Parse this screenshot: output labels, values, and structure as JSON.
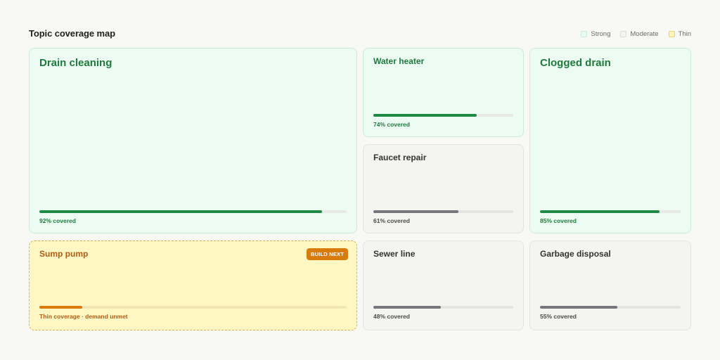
{
  "header": {
    "title": "Topic coverage map"
  },
  "legend": [
    {
      "label": "Strong",
      "color": "#edfcf2",
      "border": "#c9ecd5"
    },
    {
      "label": "Moderate",
      "color": "#f4f4f1",
      "border": "#dcdcd8"
    },
    {
      "label": "Thin",
      "color": "#fef3b8",
      "border": "#ecd27a"
    }
  ],
  "topics": {
    "drain_cleaning": {
      "name": "Drain cleaning",
      "level": "strong",
      "coverage": 0.92,
      "status": "92% covered"
    },
    "water_heater": {
      "name": "Water heater",
      "level": "strong",
      "coverage": 0.74,
      "status": "74% covered"
    },
    "faucet_repair": {
      "name": "Faucet repair",
      "level": "moderate",
      "coverage": 0.61,
      "status": "61% covered"
    },
    "clogged_drain": {
      "name": "Clogged drain",
      "level": "strong",
      "coverage": 0.85,
      "status": "85% covered"
    },
    "sump_pump": {
      "name": "Sump pump",
      "level": "thin",
      "coverage": 0.14,
      "status": "Thin coverage · demand unmet",
      "badge": "BUILD NEXT"
    },
    "sewer_line": {
      "name": "Sewer line",
      "level": "moderate",
      "coverage": 0.48,
      "status": "48% covered"
    },
    "garbage_disposal": {
      "name": "Garbage disposal",
      "level": "moderate",
      "coverage": 0.55,
      "status": "55% covered"
    }
  }
}
